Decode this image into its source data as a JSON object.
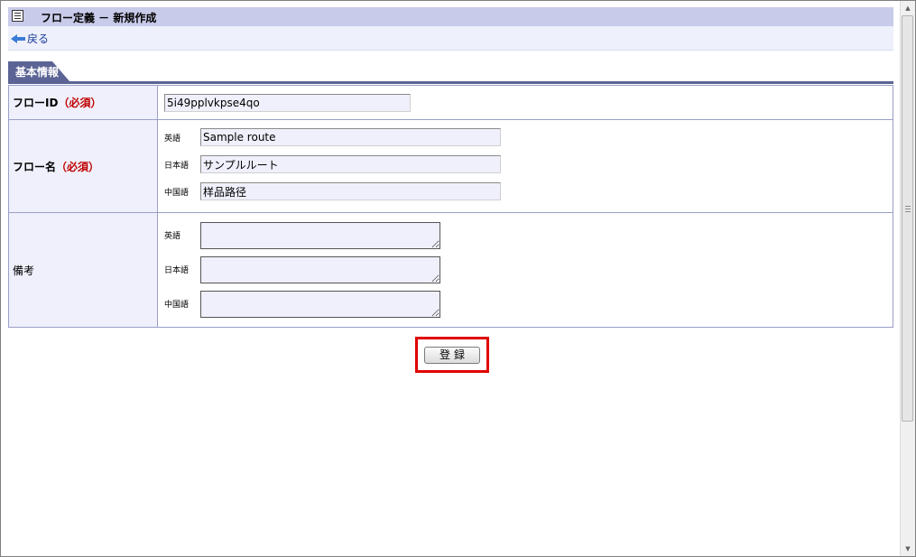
{
  "header": {
    "title": "フロー定義 － 新規作成",
    "icon": "document-icon"
  },
  "nav": {
    "back_label": "戻る",
    "back_icon": "back-arrow-icon"
  },
  "section": {
    "tab_label": "基本情報"
  },
  "form": {
    "flow_id": {
      "label": "フローID",
      "required": "（必須）",
      "value": "5i49pplvkpse4qo"
    },
    "flow_name": {
      "label": "フロー名",
      "required": "（必須）",
      "langs": [
        {
          "lang": "英語",
          "value": "Sample route"
        },
        {
          "lang": "日本語",
          "value": "サンプルルート"
        },
        {
          "lang": "中国語",
          "value": "样品路径"
        }
      ]
    },
    "notes": {
      "label": "備考",
      "langs": [
        {
          "lang": "英語",
          "value": ""
        },
        {
          "lang": "日本語",
          "value": ""
        },
        {
          "lang": "中国語",
          "value": ""
        }
      ]
    }
  },
  "actions": {
    "submit_label": "登録"
  },
  "colors": {
    "title_bar": "#c9cbea",
    "tab": "#5b6494",
    "required": "#c00000",
    "highlight": "#e00000",
    "field_bg": "#eff0fb"
  }
}
